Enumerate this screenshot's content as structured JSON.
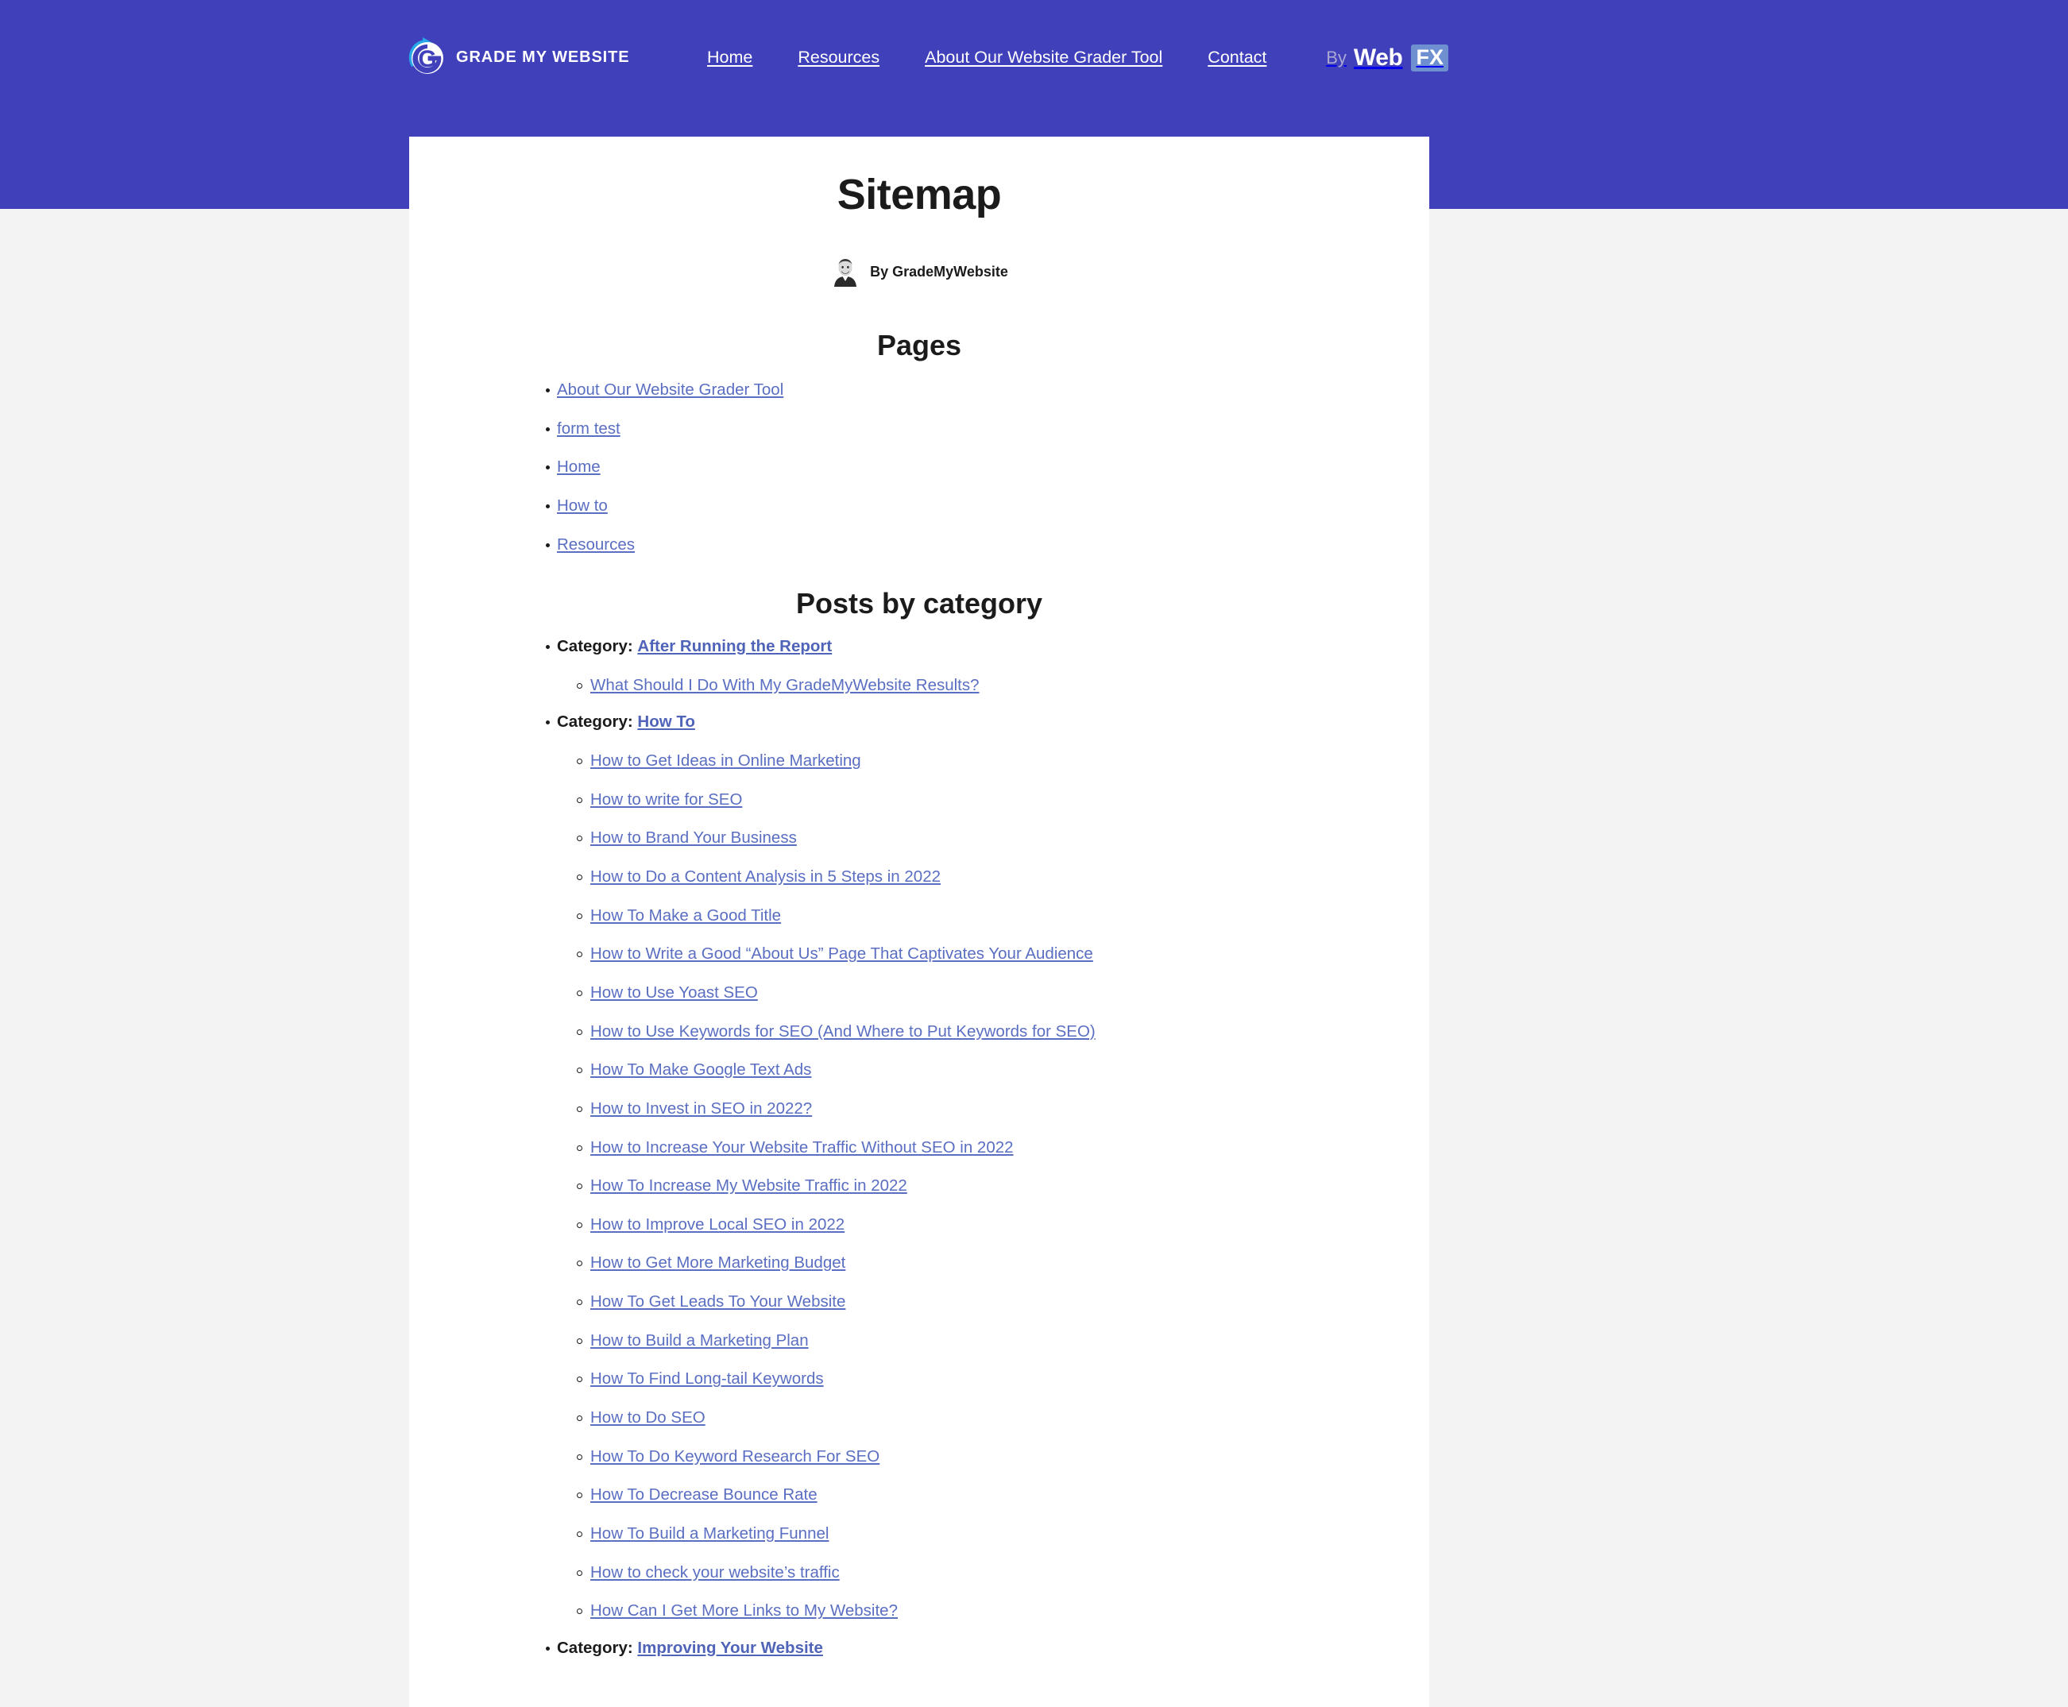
{
  "theme": {
    "header_bg": "#4040bb",
    "page_bg": "#f3f3f3",
    "card_bg": "#ffffff",
    "link_color": "#5a6ec2",
    "category_link_color": "#4f63b8",
    "fx_badge_bg": "#6e8fd0",
    "logo_arrow_color": "#27a8e8"
  },
  "header": {
    "logo_text": "GRADE MY WEBSITE",
    "nav": [
      {
        "label": "Home"
      },
      {
        "label": "Resources"
      },
      {
        "label": "About Our Website Grader Tool"
      },
      {
        "label": "Contact"
      }
    ],
    "webfx": {
      "by": "By",
      "web": "Web",
      "fx": "FX"
    }
  },
  "article": {
    "title": "Sitemap",
    "byline": "By GradeMyWebsite"
  },
  "pages_section": {
    "heading": "Pages",
    "items": [
      {
        "label": "About Our Website Grader Tool"
      },
      {
        "label": "form test"
      },
      {
        "label": "Home"
      },
      {
        "label": "How to"
      },
      {
        "label": "Resources"
      }
    ]
  },
  "posts_section": {
    "heading": "Posts by category",
    "category_prefix": "Category:",
    "categories": [
      {
        "name": "After Running the Report",
        "posts": [
          {
            "label": "What Should I Do With My GradeMyWebsite Results?"
          }
        ]
      },
      {
        "name": "How To",
        "posts": [
          {
            "label": "How to Get Ideas in Online Marketing"
          },
          {
            "label": "How to write for SEO"
          },
          {
            "label": "How to Brand Your Business"
          },
          {
            "label": "How to Do a Content Analysis in 5 Steps in 2022"
          },
          {
            "label": "How To Make a Good Title"
          },
          {
            "label": "How to Write a Good “About Us” Page That Captivates Your Audience"
          },
          {
            "label": "How to Use Yoast SEO"
          },
          {
            "label": "How to Use Keywords for SEO (And Where to Put Keywords for SEO)"
          },
          {
            "label": "How To Make Google Text Ads"
          },
          {
            "label": "How to Invest in SEO in 2022?"
          },
          {
            "label": "How to Increase Your Website Traffic Without SEO in 2022"
          },
          {
            "label": "How To Increase My Website Traffic in 2022"
          },
          {
            "label": "How to Improve Local SEO in 2022"
          },
          {
            "label": "How to Get More Marketing Budget"
          },
          {
            "label": "How To Get Leads To Your Website"
          },
          {
            "label": "How to Build a Marketing Plan"
          },
          {
            "label": "How To Find Long-tail Keywords"
          },
          {
            "label": "How to Do SEO"
          },
          {
            "label": "How To Do Keyword Research For SEO"
          },
          {
            "label": "How To Decrease Bounce Rate"
          },
          {
            "label": "How To Build a Marketing Funnel"
          },
          {
            "label": "How to check your website’s traffic"
          },
          {
            "label": "How Can I Get More Links to My Website?"
          }
        ]
      },
      {
        "name": "Improving Your Website",
        "posts": []
      }
    ]
  }
}
